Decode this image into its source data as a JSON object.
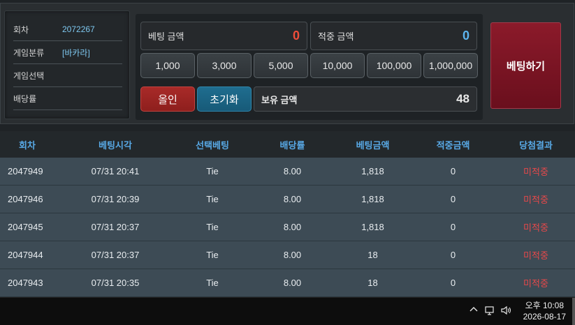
{
  "info": {
    "round_label": "회차",
    "round_value": "2072267",
    "category_label": "게임분류",
    "category_value": "[바카라]",
    "selection_label": "게임선택",
    "selection_value": "",
    "odds_label": "배당률",
    "odds_value": ""
  },
  "bet": {
    "bet_amount_label": "베팅 금액",
    "bet_amount_value": "0",
    "win_amount_label": "적중 금액",
    "win_amount_value": "0",
    "chips": [
      "1,000",
      "3,000",
      "5,000",
      "10,000",
      "100,000",
      "1,000,000"
    ],
    "allin_label": "올인",
    "reset_label": "초기화",
    "hold_label": "보유 금액",
    "hold_value": "48",
    "submit_label": "베팅하기"
  },
  "table": {
    "headers": [
      "회차",
      "베팅시각",
      "선택베팅",
      "배당률",
      "베팅금액",
      "적중금액",
      "당첨결과"
    ],
    "rows": [
      [
        "2047949",
        "07/31 20:41",
        "Tie",
        "8.00",
        "1,818",
        "0",
        "미적중"
      ],
      [
        "2047946",
        "07/31 20:39",
        "Tie",
        "8.00",
        "1,818",
        "0",
        "미적중"
      ],
      [
        "2047945",
        "07/31 20:37",
        "Tie",
        "8.00",
        "1,818",
        "0",
        "미적중"
      ],
      [
        "2047944",
        "07/31 20:37",
        "Tie",
        "8.00",
        "18",
        "0",
        "미적중"
      ],
      [
        "2047943",
        "07/31 20:35",
        "Tie",
        "8.00",
        "18",
        "0",
        "미적중"
      ]
    ]
  },
  "taskbar": {
    "time": "오후 10:08",
    "date": "2026-08-17",
    "icons": [
      "chevron-up-icon",
      "network-icon",
      "volume-icon"
    ]
  },
  "colors": {
    "accent_blue": "#58a9e6",
    "accent_red": "#ef4d3a",
    "bet_button": "#7a1424"
  }
}
